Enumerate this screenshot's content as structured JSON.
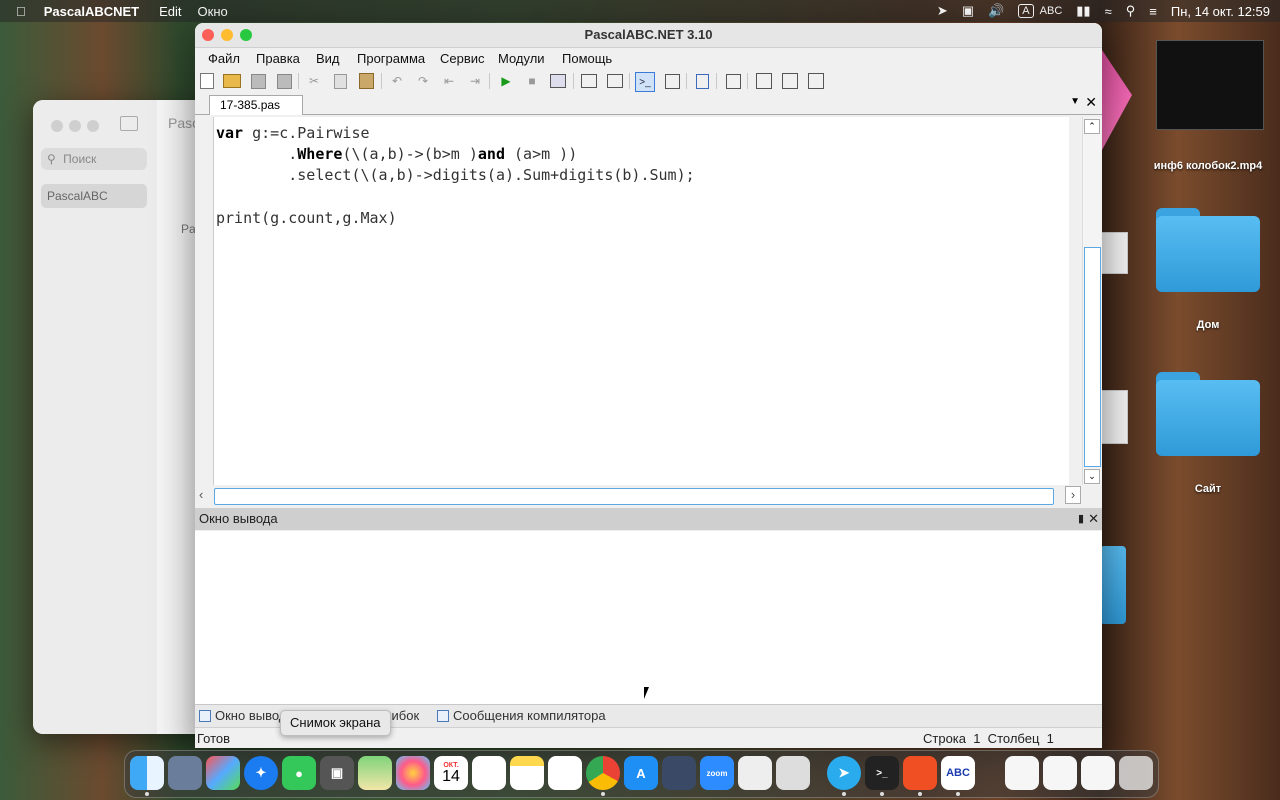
{
  "menubar": {
    "app_name": "PascalABCNET",
    "items": [
      "Edit",
      "Окно"
    ],
    "input_source": "ABC",
    "datetime": "Пн, 14 окт.  12:59"
  },
  "finder": {
    "search_placeholder": "Поиск",
    "sidebar_selected": "PascalABC",
    "header_fragment": "Pasc",
    "content_fragment": "Pa"
  },
  "desktop": {
    "items": [
      {
        "label": "инф6 колобок2.mp4",
        "icon": "video-thumbnail-icon"
      },
      {
        "label": "Дом",
        "icon": "folder-icon"
      },
      {
        "label": "Сайт",
        "icon": "folder-icon"
      }
    ]
  },
  "window": {
    "title": "PascalABC.NET 3.10",
    "menu": [
      "Файл",
      "Правка",
      "Вид",
      "Программа",
      "Сервис",
      "Модули",
      "Помощь"
    ],
    "file_tab": "17-385.pas",
    "code": {
      "l1_kw": "var",
      "l1_rest": " g:=c.Pairwise",
      "l2_indent": "        .",
      "l2_kw": "Where",
      "l2_mid": "(\\(a,b)->(b>m )",
      "l2_kw2": "and",
      "l2_end": " (a>m ))",
      "l3": "        .select(\\(a,b)->digits(a).Sum+digits(b).Sum);",
      "l5": "print(g.count,g.Max)"
    },
    "output_title": "Окно вывода",
    "bottom_tabs": [
      "Окно вывода",
      "Список ошибок",
      "Сообщения компилятора"
    ],
    "status_left": "Готов",
    "status_right": "Строка  1  Столбец  1"
  },
  "tooltip": "Снимок экрана",
  "dock": {
    "apps": [
      "finder",
      "preview",
      "launchpad",
      "safari",
      "messages",
      "screenshot",
      "maps",
      "photos",
      "calendar",
      "reminders",
      "notes",
      "freeform",
      "chrome",
      "app-store",
      "system-monitor",
      "zoom",
      "textedit",
      "books",
      "telegram",
      "terminal",
      "office",
      "pascalabc",
      "document",
      "downloads",
      "trash"
    ],
    "calendar_month": "ОКТ.",
    "calendar_day": "14",
    "zoom_label": "zoom",
    "abc_label": "ABC"
  },
  "colors": {
    "accent": "#3a8ee6",
    "folder": "#3aa3e0"
  }
}
